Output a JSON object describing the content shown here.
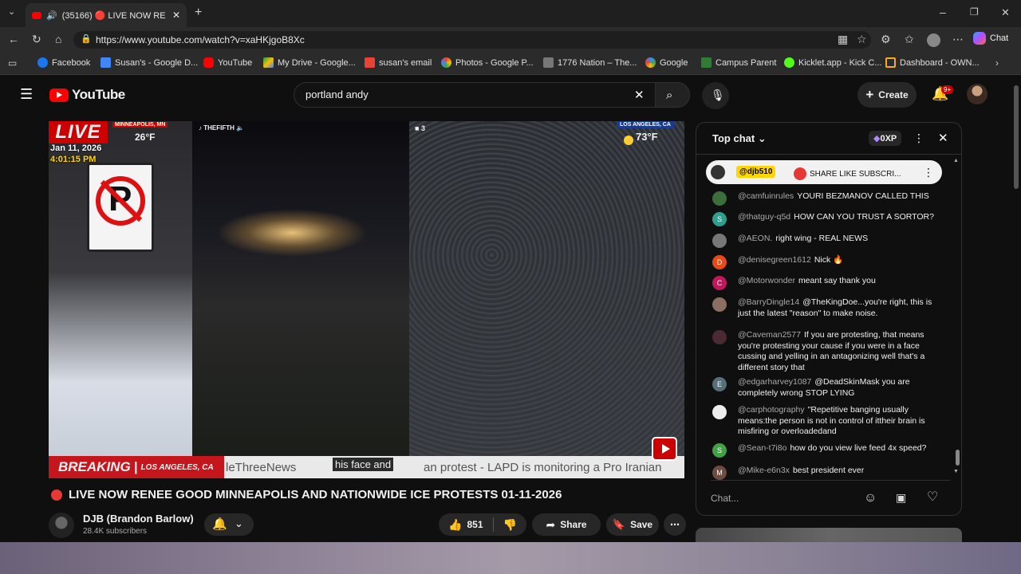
{
  "browser": {
    "tab_title": "(35166) 🔴 LIVE NOW RENEE",
    "url": "https://www.youtube.com/watch?v=xaHKjgoB8Xc",
    "chat_label": "Chat",
    "bookmarks": [
      {
        "label": "Facebook",
        "color": "#1877f2"
      },
      {
        "label": "Susan's - Google D...",
        "color": "#4285f4"
      },
      {
        "label": "YouTube",
        "color": "#ff0000"
      },
      {
        "label": "My Drive - Google...",
        "color": "#fbbc04"
      },
      {
        "label": "susan's email",
        "color": "#ea4335"
      },
      {
        "label": "Photos - Google P...",
        "color": "#34a853"
      },
      {
        "label": "1776 Nation – The...",
        "color": "#777777"
      },
      {
        "label": "Google",
        "color": "#ffffff"
      },
      {
        "label": "Campus Parent",
        "color": "#2e7d32"
      },
      {
        "label": "Kicklet.app - Kick C...",
        "color": "#53fc18"
      },
      {
        "label": "Dashboard - OWN...",
        "color": "#f9a825"
      }
    ]
  },
  "youtube": {
    "logo_text": "YouTube",
    "search_value": "portland andy",
    "create_label": "Create",
    "notif_count": "9+"
  },
  "video": {
    "live_label": "LIVE",
    "loc_left": "MINNEAPOLIS, MN",
    "temp_left": "26°F",
    "date": "Jan 11, 2026",
    "time": "4:01:15 PM",
    "tiktok_handle": "THEFIFTH",
    "viewers": "3",
    "loc_right": "LOS ANGELES, CA",
    "temp_right": "73°F",
    "breaking": "BREAKING",
    "breaking_loc": "LOS ANGELES, CA",
    "ticker_1": "leThreeNews",
    "ticker_2": "an protest - LAPD is monitoring a Pro Iranian",
    "caption": "his face and",
    "title": "LIVE NOW RENEE GOOD MINNEAPOLIS AND NATIONWIDE ICE PROTESTS 01-11-2026",
    "channel": "DJB (Brandon Barlow)",
    "subscribers": "28.4K subscribers",
    "likes": "851",
    "share_label": "Share",
    "save_label": "Save"
  },
  "chat": {
    "header": "Top chat",
    "xp": "0XP",
    "pinned_author": "@djb510",
    "pinned_message": "SHARE LIKE SUBSCRI...",
    "input_placeholder": "Chat...",
    "messages": [
      {
        "author": "@camfuinrules",
        "text": "YOURI BEZMANOV CALLED THIS",
        "avatar": "",
        "color": "#3b6e3b"
      },
      {
        "author": "@thatguy-q5d",
        "text": "HOW CAN YOU TRUST A SORTOR?",
        "avatar": "S",
        "color": "#2e9e8f"
      },
      {
        "author": "@AEON.",
        "text": "right wing - REAL NEWS",
        "avatar": "",
        "color": "#777777"
      },
      {
        "author": "@denisegreen1612",
        "text": "Nick 🔥",
        "avatar": "D",
        "color": "#e64a19"
      },
      {
        "author": "@Motorwonder",
        "text": "meant say thank you",
        "avatar": "C",
        "color": "#c2185b"
      },
      {
        "author": "@BarryDingle14",
        "text": "@TheKingDoe...you're right, this is just the latest \"reason\" to make noise.",
        "avatar": "",
        "color": "#8d6e63"
      },
      {
        "author": "@Caveman2577",
        "text": "If you are protesting, that means you're protesting your cause if you were in a face cussing and yelling in an antagonizing well that's a different story that",
        "avatar": "",
        "color": "#4a2a33"
      },
      {
        "author": "@edgarharvey1087",
        "text": "@DeadSkinMask you are completely wrong STOP LYING",
        "avatar": "E",
        "color": "#546e7a"
      },
      {
        "author": "@carphotography",
        "text": "\"Repetitive banging usually means:the person is not in control of ittheir brain is misfiring or overloadedand",
        "avatar": "",
        "color": "#eeeeee"
      },
      {
        "author": "@Sean-t7i8o",
        "text": "how do you view live feed 4x speed?",
        "avatar": "S",
        "color": "#43a047"
      },
      {
        "author": "@Mike-e6n3x",
        "text": "best president ever",
        "avatar": "M",
        "color": "#6d4c41"
      }
    ]
  }
}
